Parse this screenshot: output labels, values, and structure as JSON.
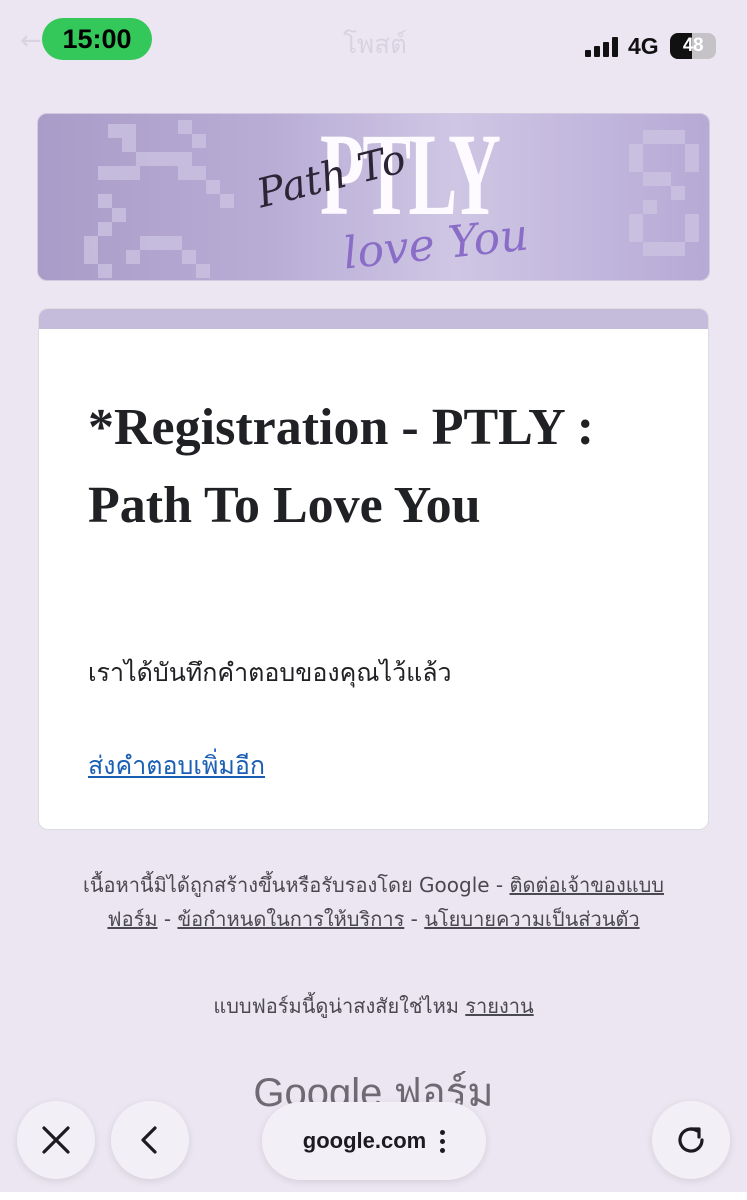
{
  "status_bar": {
    "time": "15:00",
    "page_title": "โพสต์",
    "network": "4G",
    "battery": "48",
    "battery_level": 0.48
  },
  "banner": {
    "logo_text": "PTLY",
    "script_line_1": "Path To",
    "script_line_2": "love You"
  },
  "card": {
    "title": "*Registration - PTLY : Path To Love You",
    "message": "เราได้บันทึกคำตอบของคุณไว้แล้ว",
    "link": "ส่งคำตอบเพิ่มอีก"
  },
  "footer": {
    "disclaimer": "เนื้อหานี้มิได้ถูกสร้างขึ้นหรือรับรองโดย Google -",
    "contact_link": "ติดต่อเจ้าของแบบฟอร์ม",
    "terms_link": "ข้อกำหนดในการให้บริการ",
    "privacy_link": "นโยบายความเป็นส่วนตัว",
    "separator": "-",
    "suspicious_text": "แบบฟอร์มนี้ดูน่าสงสัยใช่ไหม",
    "report_link": "รายงาน",
    "brand": "Google ฟอร์ม"
  },
  "browser_bar": {
    "url": "google.com"
  },
  "colors": {
    "accent": "#c5bbdb",
    "link": "#1a5fb4",
    "background": "#ece6f2",
    "time_pill": "#34c759"
  }
}
